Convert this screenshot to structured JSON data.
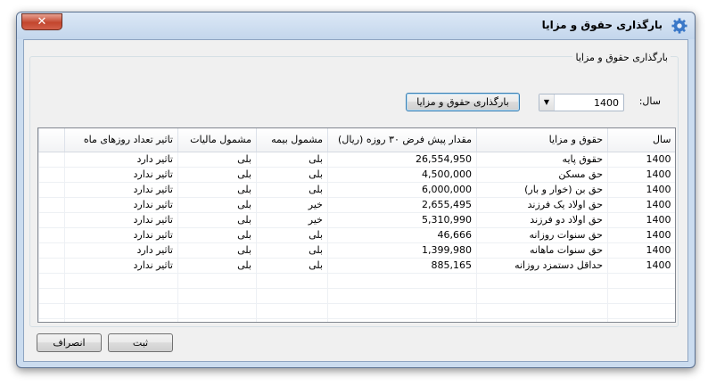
{
  "window": {
    "title": "بارگذاری حقوق و مزایا",
    "close_label": "✕",
    "icon": "gear-icon"
  },
  "group": {
    "title": "بارگذاری حقوق و مزایا"
  },
  "filter": {
    "year_label": "سال:",
    "year_value": "1400",
    "load_button": "بارگذاری حقوق و مزایا"
  },
  "table": {
    "headers": [
      "سال",
      "حقوق و مزایا",
      "مقدار پیش فرض ۳۰ روزه (ریال)",
      "مشمول بیمه",
      "مشمول مالیات",
      "تاثیر تعداد روزهای ماه"
    ],
    "rows": [
      [
        "1400",
        "حقوق پایه",
        "26,554,950",
        "بلی",
        "بلی",
        "تاثیر دارد"
      ],
      [
        "1400",
        "حق مسکن",
        "4,500,000",
        "بلی",
        "بلی",
        "تاثیر ندارد"
      ],
      [
        "1400",
        "حق بن (خوار و بار)",
        "6,000,000",
        "بلی",
        "بلی",
        "تاثیر ندارد"
      ],
      [
        "1400",
        "حق اولاد یک فرزند",
        "2,655,495",
        "خیر",
        "بلی",
        "تاثیر ندارد"
      ],
      [
        "1400",
        "حق اولاد دو فرزند",
        "5,310,990",
        "خیر",
        "بلی",
        "تاثیر ندارد"
      ],
      [
        "1400",
        "حق سنوات روزانه",
        "46,666",
        "بلی",
        "بلی",
        "تاثیر ندارد"
      ],
      [
        "1400",
        "حق سنوات ماهانه",
        "1,399,980",
        "بلی",
        "بلی",
        "تاثیر دارد"
      ],
      [
        "1400",
        "حداقل دستمزد روزانه",
        "885,165",
        "بلی",
        "بلی",
        "تاثیر ندارد"
      ]
    ]
  },
  "footer": {
    "ok_label": "ثبت",
    "cancel_label": "انصراف"
  },
  "colors": {
    "frame": "#cbdcef",
    "client": "#f0f0f0",
    "close": "#c3462e"
  }
}
